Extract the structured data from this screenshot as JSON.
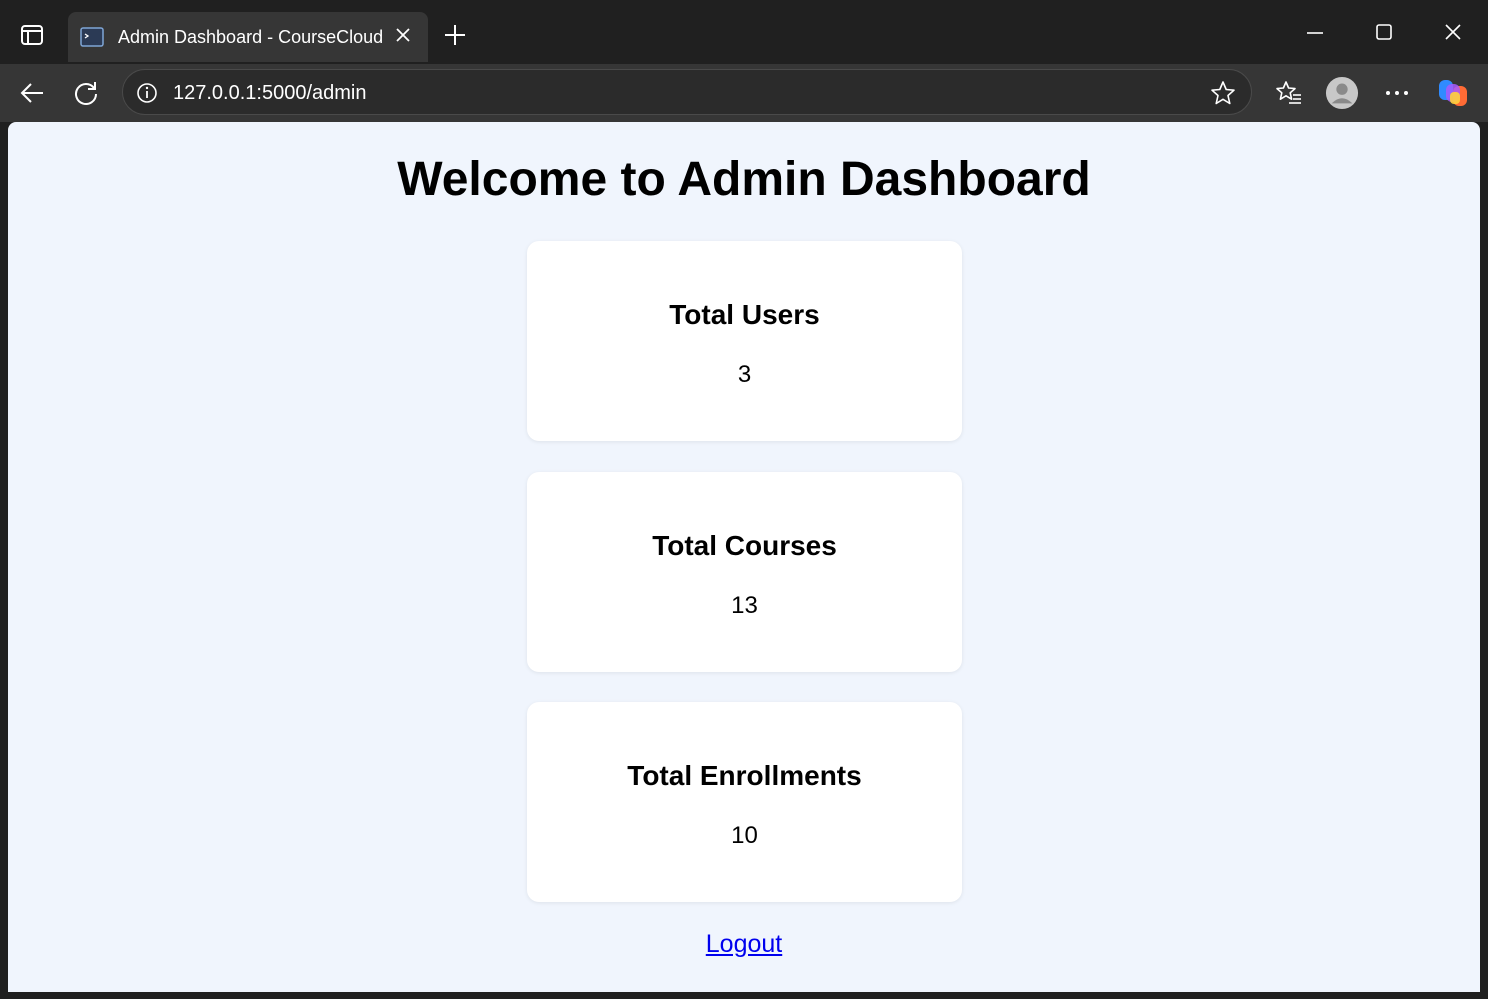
{
  "browser": {
    "tab": {
      "title": "Admin Dashboard - CourseCloud"
    },
    "address": {
      "url": "127.0.0.1:5000/admin"
    }
  },
  "page": {
    "heading": "Welcome to Admin Dashboard",
    "cards": [
      {
        "label": "Total Users",
        "value": "3"
      },
      {
        "label": "Total Courses",
        "value": "13"
      },
      {
        "label": "Total Enrollments",
        "value": "10"
      }
    ],
    "logout_label": "Logout"
  },
  "icons": {
    "tab_favicon": "terminal-icon",
    "sidebar_toggle": "sidebar-icon",
    "new_tab": "plus-icon",
    "minimize": "minimize-icon",
    "maximize": "maximize-icon",
    "close": "close-icon",
    "back": "back-arrow-icon",
    "refresh": "refresh-icon",
    "site_info": "info-icon",
    "favorite": "star-icon",
    "favorites_list": "favorites-icon",
    "profile": "avatar-icon",
    "more": "ellipsis-icon",
    "copilot": "copilot-icon"
  },
  "colors": {
    "chrome_dark": "#202020",
    "toolbar": "#363636",
    "page_background": "#f0f5fd",
    "card_background": "#ffffff",
    "link": "#0000ee"
  }
}
